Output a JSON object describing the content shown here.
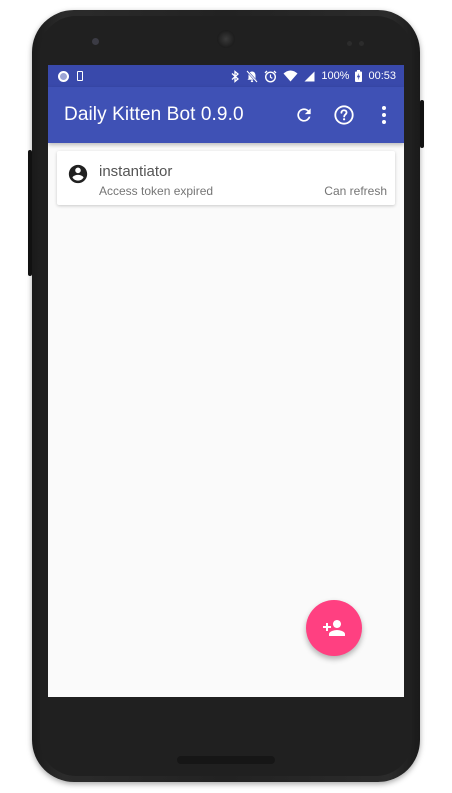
{
  "statusbar": {
    "battery": "100%",
    "time": "00:53"
  },
  "appbar": {
    "title": "Daily Kitten Bot 0.9.0",
    "actions": [
      "refresh-icon",
      "help-icon",
      "more-vert-icon"
    ]
  },
  "accounts": [
    {
      "name": "instantiator",
      "status": "Access token expired",
      "refresh": "Can refresh"
    }
  ],
  "fab": {
    "icon": "add-person-icon"
  },
  "colors": {
    "primary": "#3f51b5",
    "primary_dark": "#3949ab",
    "accent": "#ff4081",
    "background": "#fafafa"
  }
}
